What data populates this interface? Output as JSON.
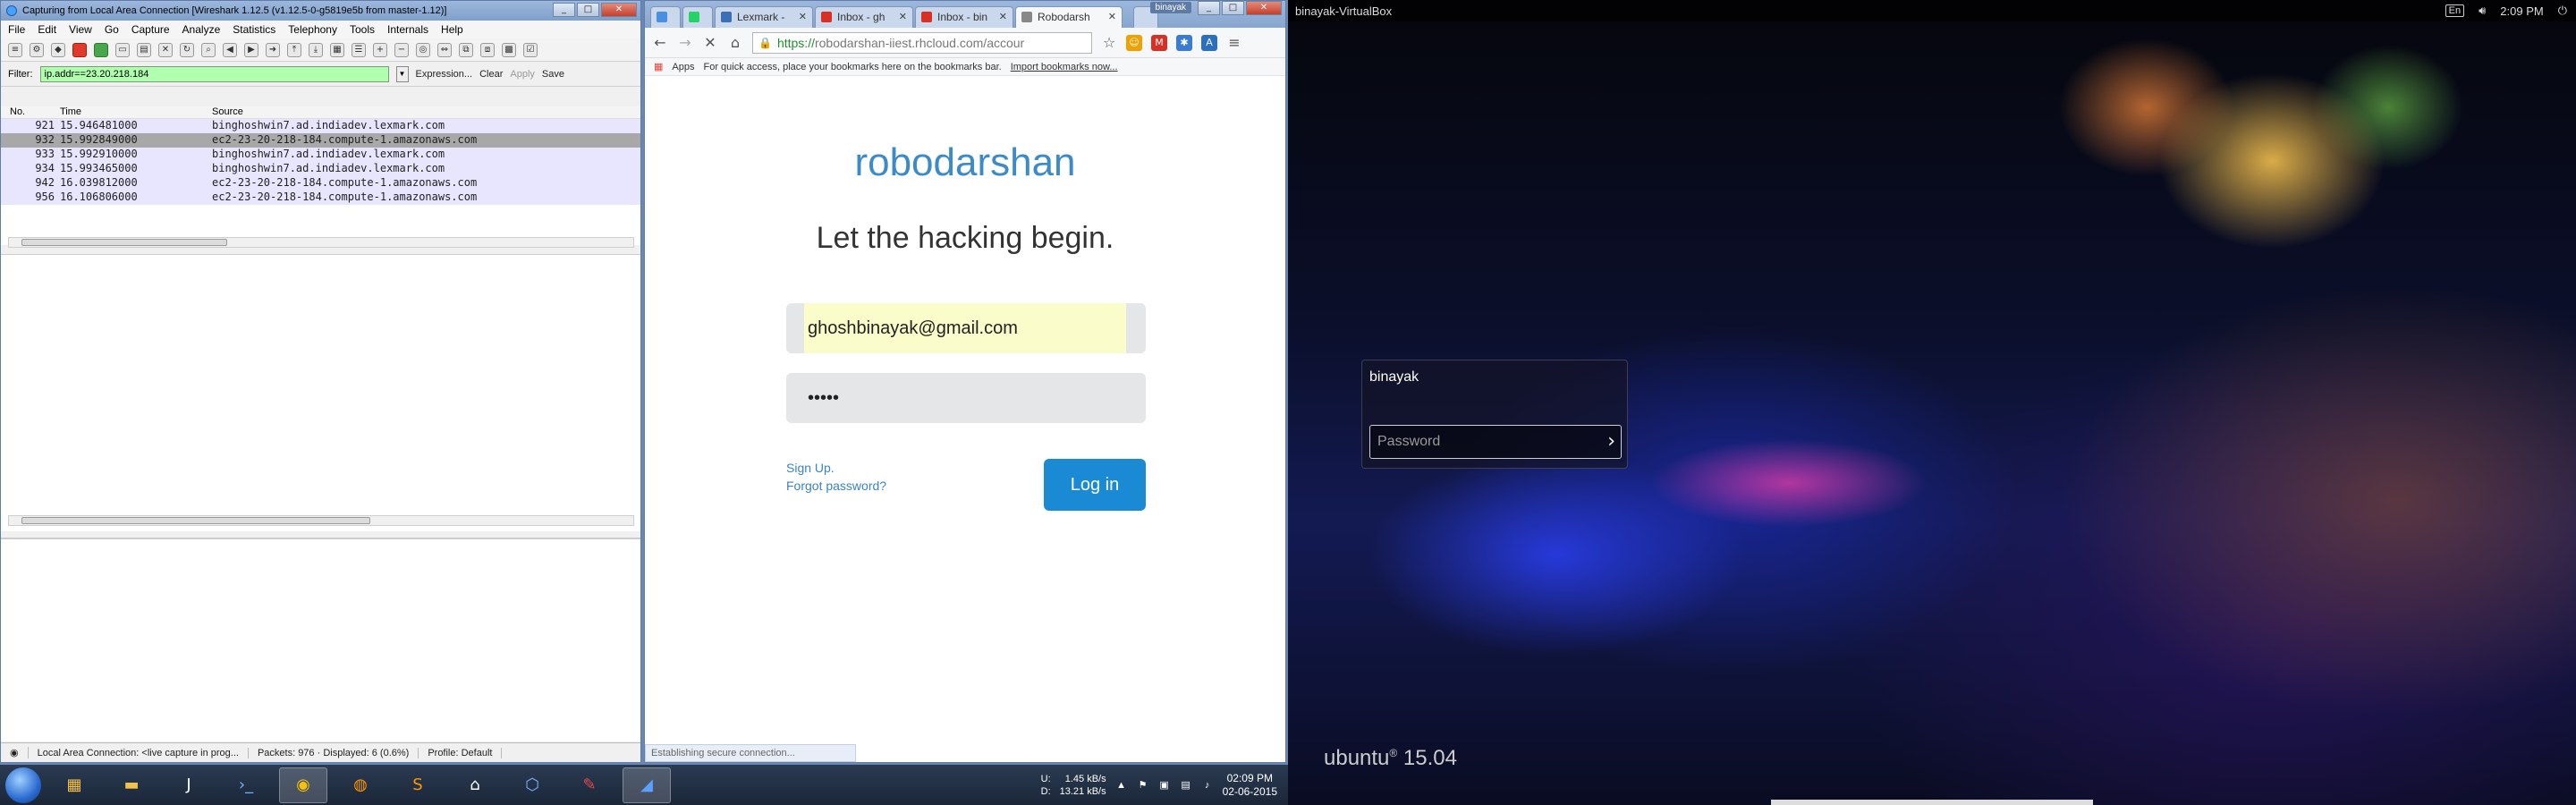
{
  "wireshark": {
    "title": "Capturing from Local Area Connection   [Wireshark 1.12.5   (v1.12.5-0-g5819e5b from master-1.12)]",
    "menu": [
      "File",
      "Edit",
      "View",
      "Go",
      "Capture",
      "Analyze",
      "Statistics",
      "Telephony",
      "Tools",
      "Internals",
      "Help"
    ],
    "filter_label": "Filter:",
    "filter_value": "ip.addr==23.20.218.184",
    "filter_actions": [
      "Expression...",
      "Clear",
      "Apply",
      "Save"
    ],
    "columns": [
      "No.",
      "Time",
      "Source"
    ],
    "packets": [
      {
        "no": "921",
        "time": "15.946481000",
        "source": "binghoshwin7.ad.indiadev.lexmark.com",
        "selected": false
      },
      {
        "no": "932",
        "time": "15.992849000",
        "source": "ec2-23-20-218-184.compute-1.amazonaws.com",
        "selected": true
      },
      {
        "no": "933",
        "time": "15.992910000",
        "source": "binghoshwin7.ad.indiadev.lexmark.com",
        "selected": false
      },
      {
        "no": "934",
        "time": "15.993465000",
        "source": "binghoshwin7.ad.indiadev.lexmark.com",
        "selected": false
      },
      {
        "no": "942",
        "time": "16.039812000",
        "source": "ec2-23-20-218-184.compute-1.amazonaws.com",
        "selected": false
      },
      {
        "no": "956",
        "time": "16.106806000",
        "source": "ec2-23-20-218-184.compute-1.amazonaws.com",
        "selected": false
      }
    ],
    "status": {
      "iface": "Local Area Connection: <live capture in prog...",
      "packets": "Packets: 976 · Displayed: 6 (0.6%)",
      "profile": "Profile: Default"
    }
  },
  "chrome": {
    "profile_badge": "binayak",
    "tabs": [
      {
        "label": "",
        "color": "#4a90e2"
      },
      {
        "label": "",
        "color": "#25d366"
      },
      {
        "label": "Lexmark -",
        "color": "#3b6fb6"
      },
      {
        "label": "Inbox - gh",
        "color": "#d93025"
      },
      {
        "label": "Inbox - bin",
        "color": "#d93025"
      },
      {
        "label": "Robodarsh",
        "color": "#888888"
      }
    ],
    "url_scheme": "https://",
    "url_rest": "robodarshan-iiest.rhcloud.com/accour",
    "apps_label": "Apps",
    "bookmarks_hint": "For quick access, place your bookmarks here on the bookmarks bar.",
    "import_link": "Import bookmarks now...",
    "status": "Establishing secure connection...",
    "page": {
      "brand": "robodarshan",
      "tagline": "Let the hacking begin.",
      "email": "ghoshbinayak@gmail.com",
      "password_mask": "•••••",
      "signup": "Sign Up.",
      "forgot": "Forgot password?",
      "login": "Log in"
    }
  },
  "taskbar": {
    "net_up": "1.45 kB/s",
    "net_down": "13.21 kB/s",
    "net_u": "U:",
    "net_d": "D:",
    "time": "02:09 PM",
    "date": "02-06-2015"
  },
  "ubuntu": {
    "host": "binayak-VirtualBox",
    "kbd": "En",
    "time": "2:09 PM",
    "username": "binayak",
    "password_placeholder": "Password",
    "logo": "ubuntu",
    "version": "15.04"
  }
}
